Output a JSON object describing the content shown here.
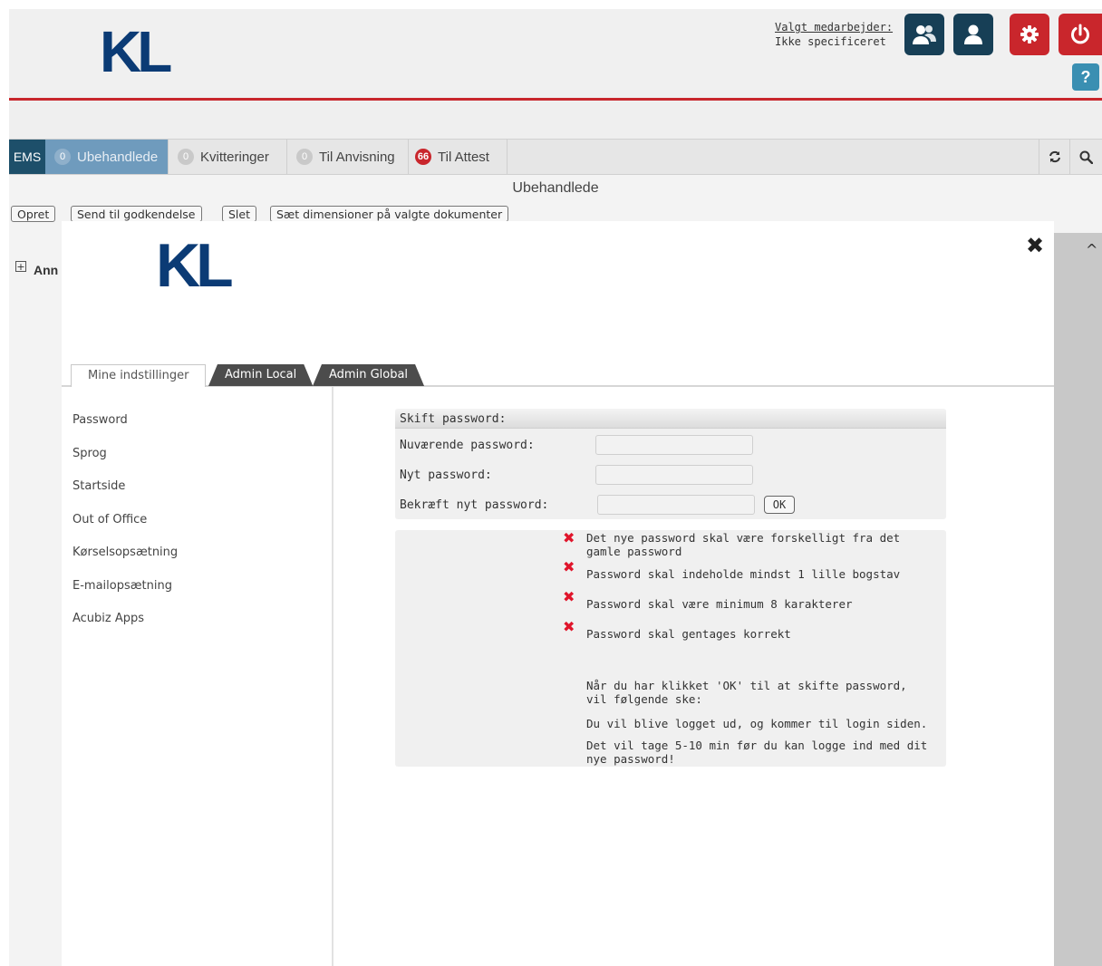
{
  "header": {
    "logo": "KL",
    "valgt_label": "Valgt medarbejder:",
    "valgt_value": "Ikke specificeret",
    "help_label": "?"
  },
  "tabbar": {
    "ems": "EMS",
    "items": [
      {
        "badge": "0",
        "label": "Ubehandlede"
      },
      {
        "badge": "0",
        "label": "Kvitteringer"
      },
      {
        "badge": "0",
        "label": "Til Anvisning"
      },
      {
        "badge": "66",
        "label": "Til Attest"
      }
    ]
  },
  "page": {
    "heading": "Ubehandlede",
    "actions": [
      "Opret",
      "Send til godkendelse",
      "Slet",
      "Sæt dimensioner på valgte dokumenter"
    ],
    "tree_label": "Ann"
  },
  "modal": {
    "logo": "KL",
    "close": "✖",
    "tabs": [
      "Mine indstillinger",
      "Admin Local",
      "Admin Global"
    ],
    "menu": [
      "Password",
      "Sprog",
      "Startside",
      "Out of Office",
      "Kørselsopsætning",
      "E-mailopsætning",
      "Acubiz Apps"
    ],
    "password_form": {
      "title": "Skift password:",
      "current_label": "Nuværende password:",
      "new_label": "Nyt password:",
      "confirm_label": "Bekræft nyt password:",
      "current_value": "",
      "new_value": "",
      "confirm_value": "",
      "ok_label": "OK"
    },
    "requirements": [
      "Det nye password skal være forskelligt fra det gamle password",
      "Password skal indeholde mindst 1 lille bogstav",
      "Password skal være minimum 8 karakterer",
      "Password skal gentages korrekt"
    ],
    "info": [
      "Når du har klikket 'OK' til at skifte password, vil følgende ske:",
      "Du vil blive logget ud, og kommer til login siden.",
      "Det vil tage 5-10 min før du kan logge ind med dit nye password!"
    ]
  },
  "colors": {
    "brand_blue": "#0b3b75",
    "header_red": "#c8262c",
    "dark_button": "#173f56",
    "error_red": "#e0152b"
  }
}
